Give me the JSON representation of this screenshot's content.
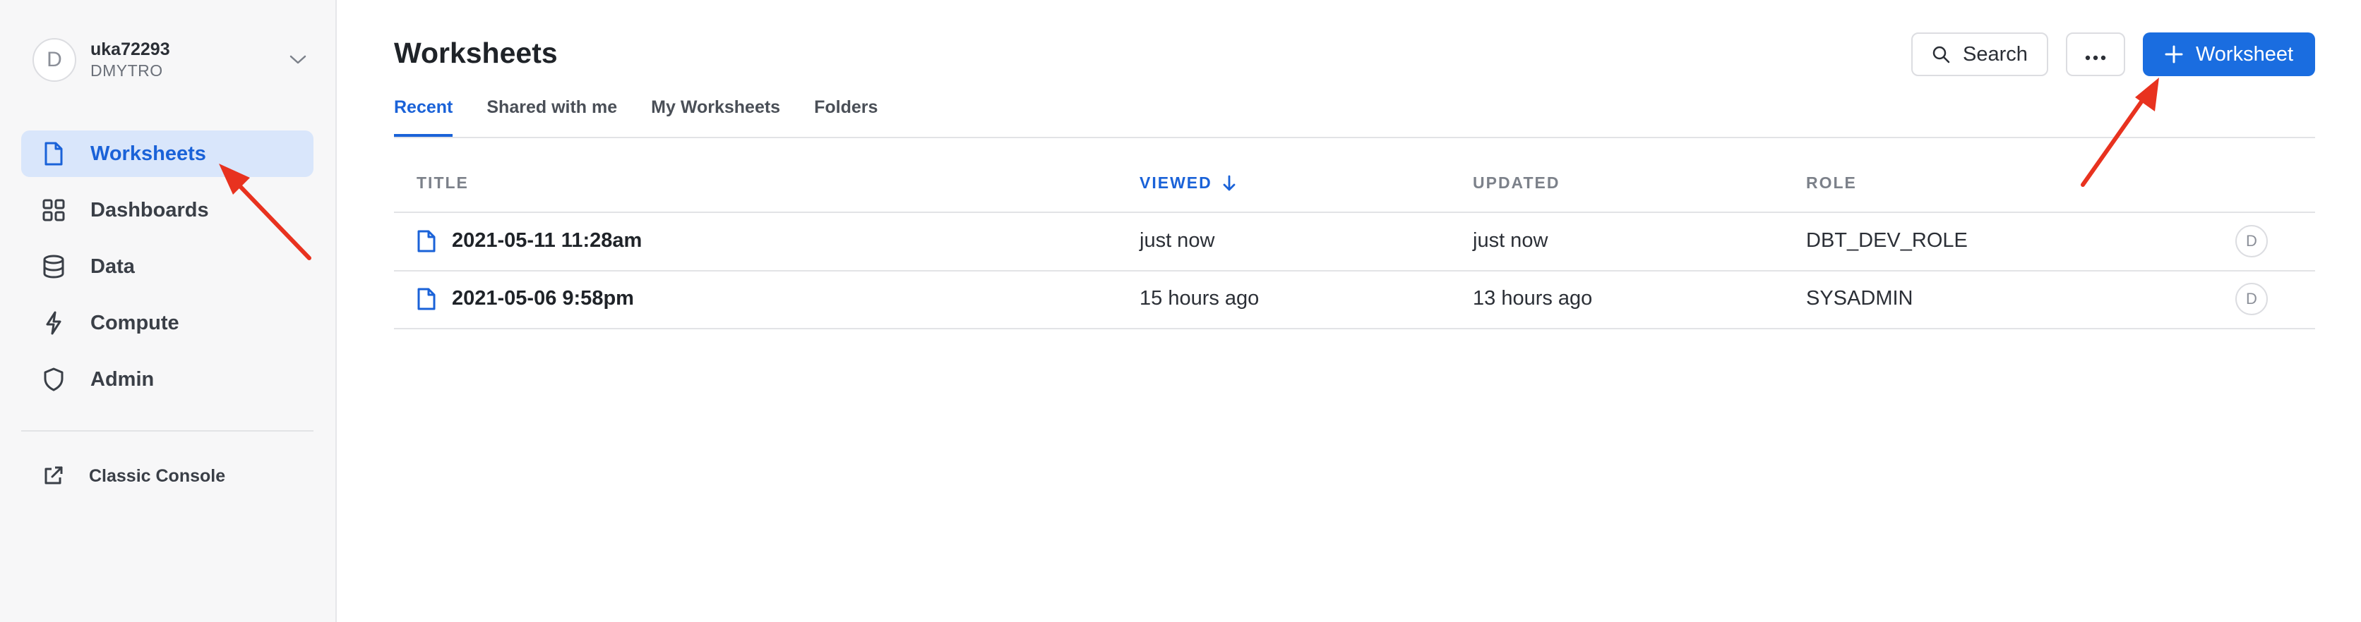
{
  "account": {
    "avatar_initial": "D",
    "name": "uka72293",
    "user": "DMYTRO"
  },
  "sidebar": {
    "items": [
      {
        "label": "Worksheets",
        "icon": "file-icon",
        "active": true
      },
      {
        "label": "Dashboards",
        "icon": "grid-icon",
        "active": false
      },
      {
        "label": "Data",
        "icon": "database-icon",
        "active": false
      },
      {
        "label": "Compute",
        "icon": "lightning-icon",
        "active": false
      },
      {
        "label": "Admin",
        "icon": "shield-icon",
        "active": false
      }
    ],
    "classic_console": "Classic Console"
  },
  "main": {
    "title": "Worksheets",
    "search_label": "Search",
    "new_label": "Worksheet",
    "tabs": [
      {
        "label": "Recent",
        "active": true
      },
      {
        "label": "Shared with me",
        "active": false
      },
      {
        "label": "My Worksheets",
        "active": false
      },
      {
        "label": "Folders",
        "active": false
      }
    ],
    "columns": [
      "TITLE",
      "VIEWED",
      "UPDATED",
      "ROLE"
    ],
    "rows": [
      {
        "title": "2021-05-11 11:28am",
        "viewed": "just now",
        "updated": "just now",
        "role": "DBT_DEV_ROLE",
        "owner": "D"
      },
      {
        "title": "2021-05-06 9:58pm",
        "viewed": "15 hours ago",
        "updated": "13 hours ago",
        "role": "SYSADMIN",
        "owner": "D"
      }
    ]
  },
  "colors": {
    "accent": "#1a6de0",
    "active_nav_bg": "#d9e6fb",
    "annotation_arrow": "#e8321f"
  }
}
